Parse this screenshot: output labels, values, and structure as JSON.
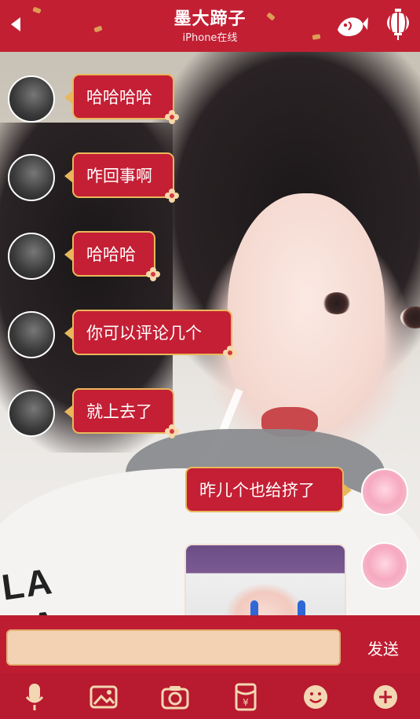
{
  "header": {
    "title": "墨大蹄子",
    "subtitle": "iPhone在线",
    "icons": {
      "back": "back-arrow-icon",
      "fish": "fish-icon",
      "lantern": "lantern-icon"
    }
  },
  "messages": [
    {
      "side": "left",
      "text": "哈哈哈哈"
    },
    {
      "side": "left",
      "text": "咋回事啊"
    },
    {
      "side": "left",
      "text": "哈哈哈"
    },
    {
      "side": "left",
      "text": "你可以评论几个"
    },
    {
      "side": "left",
      "text": "就上去了"
    },
    {
      "side": "right",
      "text": "昨儿个也给挤了"
    },
    {
      "side": "right",
      "type": "image"
    }
  ],
  "input": {
    "value": "",
    "send_label": "发送"
  },
  "toolbar": {
    "icons": [
      "microphone-icon",
      "image-icon",
      "camera-icon",
      "red-envelope-icon",
      "emoji-icon",
      "plus-icon"
    ]
  },
  "colors": {
    "theme_red": "#c21f33",
    "bubble_red": "#c41f35",
    "gold": "#e9b75b",
    "input_bg": "#f2d2b3"
  }
}
